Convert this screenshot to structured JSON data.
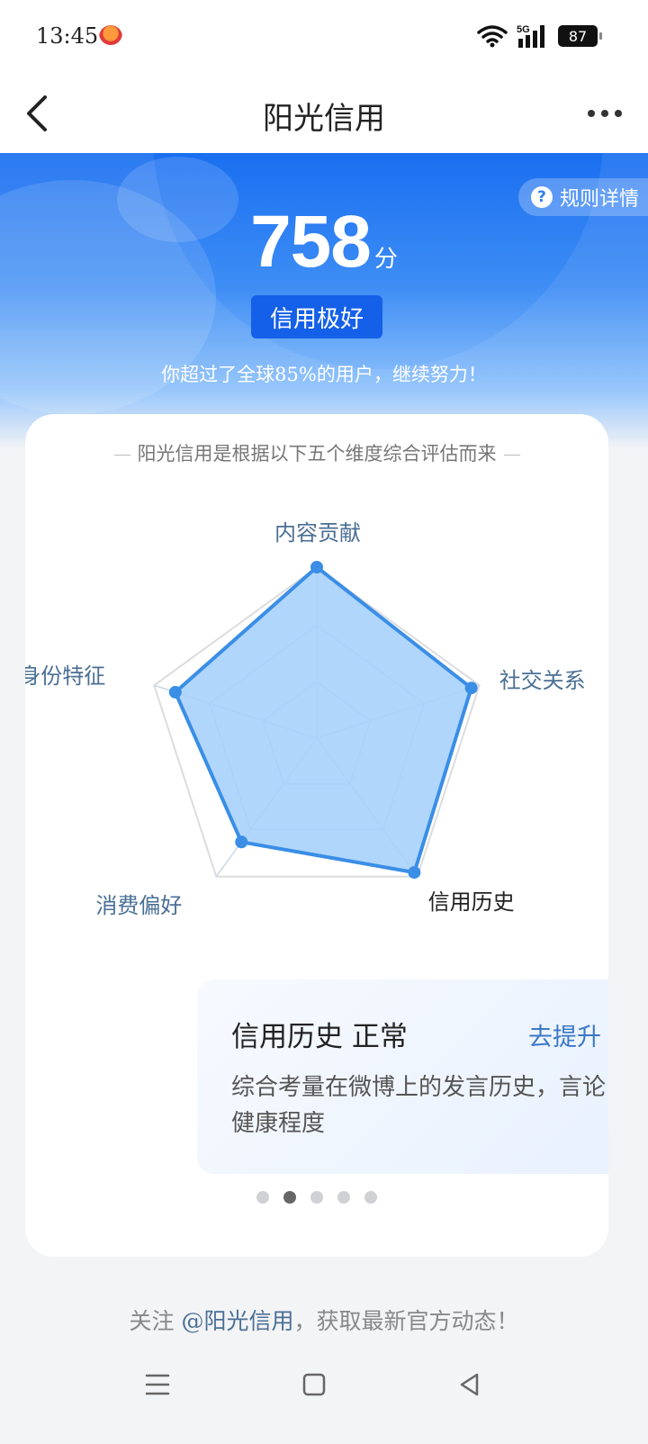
{
  "status_bar": {
    "time": "13:45",
    "battery": "87",
    "icons": [
      "app-notification-icon",
      "wifi-icon",
      "5g-signal-icon",
      "battery-icon"
    ]
  },
  "nav": {
    "title": "阳光信用",
    "back_icon": "chevron-left-icon",
    "more_icon": "more-dots-icon"
  },
  "hero": {
    "rules_label": "规则详情",
    "score": "758",
    "score_unit": "分",
    "level": "信用极好",
    "subtitle": "你超过了全球85%的用户，继续努力！"
  },
  "card": {
    "title": "阳光信用是根据以下五个维度综合评估而来",
    "dimensions": [
      {
        "name": "内容贡献",
        "value": 1.0
      },
      {
        "name": "社交关系",
        "value": 0.95
      },
      {
        "name": "信用历史",
        "value": 0.97
      },
      {
        "name": "消费偏好",
        "value": 0.75
      },
      {
        "name": "身份特征",
        "value": 0.87
      }
    ],
    "selected_dimension": "信用历史",
    "detail": {
      "title": "信用历史 正常",
      "link": "去提升 ›",
      "description": "综合考量在微博上的发言历史，言论健康程度"
    },
    "pager": {
      "count": 5,
      "active": 1
    }
  },
  "footer": {
    "prefix": "关注 ",
    "mention": "@阳光信用",
    "suffix": "，获取最新官方动态！"
  },
  "colors": {
    "primary": "#1a6ff0",
    "radar_fill": "#a9d1fb",
    "radar_stroke": "#3a8ee6",
    "label": "#4a6f95"
  }
}
